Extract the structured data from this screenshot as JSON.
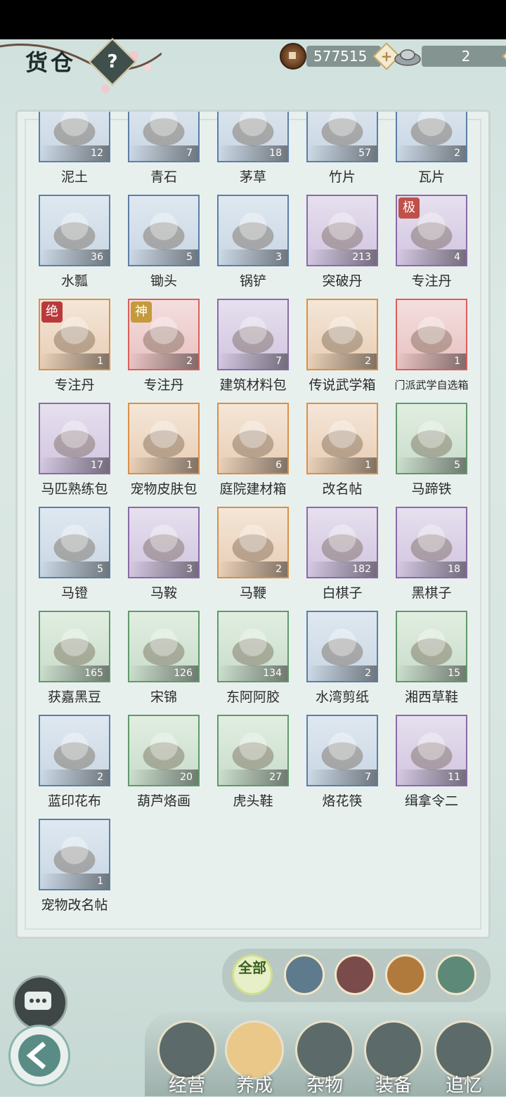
{
  "header": {
    "title": "货仓",
    "help_label": "?",
    "copper_amount": "577515",
    "silver_amount": "2",
    "plus_label": "+"
  },
  "items": [
    {
      "name": "泥土",
      "count": "12",
      "rarity": "blue"
    },
    {
      "name": "青石",
      "count": "7",
      "rarity": "blue"
    },
    {
      "name": "茅草",
      "count": "18",
      "rarity": "blue"
    },
    {
      "name": "竹片",
      "count": "57",
      "rarity": "blue"
    },
    {
      "name": "瓦片",
      "count": "2",
      "rarity": "blue"
    },
    {
      "name": "水瓢",
      "count": "36",
      "rarity": "blue"
    },
    {
      "name": "锄头",
      "count": "5",
      "rarity": "blue"
    },
    {
      "name": "锅铲",
      "count": "3",
      "rarity": "blue"
    },
    {
      "name": "突破丹",
      "count": "213",
      "rarity": "purple"
    },
    {
      "name": "专注丹",
      "count": "4",
      "rarity": "purple",
      "badge": "极"
    },
    {
      "name": "专注丹",
      "count": "1",
      "rarity": "orange",
      "badge": "绝"
    },
    {
      "name": "专注丹",
      "count": "2",
      "rarity": "red",
      "badge": "神"
    },
    {
      "name": "建筑材料包",
      "count": "7",
      "rarity": "purple"
    },
    {
      "name": "传说武学箱",
      "count": "2",
      "rarity": "orange"
    },
    {
      "name": "门派武学自选箱",
      "count": "1",
      "rarity": "red"
    },
    {
      "name": "马匹熟练包",
      "count": "17",
      "rarity": "purple"
    },
    {
      "name": "宠物皮肤包",
      "count": "1",
      "rarity": "orange"
    },
    {
      "name": "庭院建材箱",
      "count": "6",
      "rarity": "orange"
    },
    {
      "name": "改名帖",
      "count": "1",
      "rarity": "orange"
    },
    {
      "name": "马蹄铁",
      "count": "5",
      "rarity": "green"
    },
    {
      "name": "马镫",
      "count": "5",
      "rarity": "blue"
    },
    {
      "name": "马鞍",
      "count": "3",
      "rarity": "purple"
    },
    {
      "name": "马鞭",
      "count": "2",
      "rarity": "orange"
    },
    {
      "name": "白棋子",
      "count": "182",
      "rarity": "purple"
    },
    {
      "name": "黑棋子",
      "count": "18",
      "rarity": "purple"
    },
    {
      "name": "获嘉黑豆",
      "count": "165",
      "rarity": "green"
    },
    {
      "name": "宋锦",
      "count": "126",
      "rarity": "green"
    },
    {
      "name": "东阿阿胶",
      "count": "134",
      "rarity": "green"
    },
    {
      "name": "水湾剪纸",
      "count": "2",
      "rarity": "blue"
    },
    {
      "name": "湘西草鞋",
      "count": "15",
      "rarity": "green"
    },
    {
      "name": "蓝印花布",
      "count": "2",
      "rarity": "blue"
    },
    {
      "name": "葫芦烙画",
      "count": "20",
      "rarity": "green"
    },
    {
      "name": "虎头鞋",
      "count": "27",
      "rarity": "green"
    },
    {
      "name": "烙花筷",
      "count": "7",
      "rarity": "blue"
    },
    {
      "name": "缉拿令二",
      "count": "11",
      "rarity": "purple"
    },
    {
      "name": "宠物改名帖",
      "count": "1",
      "rarity": "blue"
    }
  ],
  "filters": {
    "all_label": "全部"
  },
  "bottom_nav": [
    {
      "label": "经营"
    },
    {
      "label": "养成"
    },
    {
      "label": "杂物"
    },
    {
      "label": "装备"
    },
    {
      "label": "追忆"
    }
  ],
  "colors": {
    "blue": "#5b7fa6",
    "green": "#5f9a6a",
    "purple": "#8a6aa8",
    "orange": "#d99048",
    "red": "#d9605c"
  }
}
